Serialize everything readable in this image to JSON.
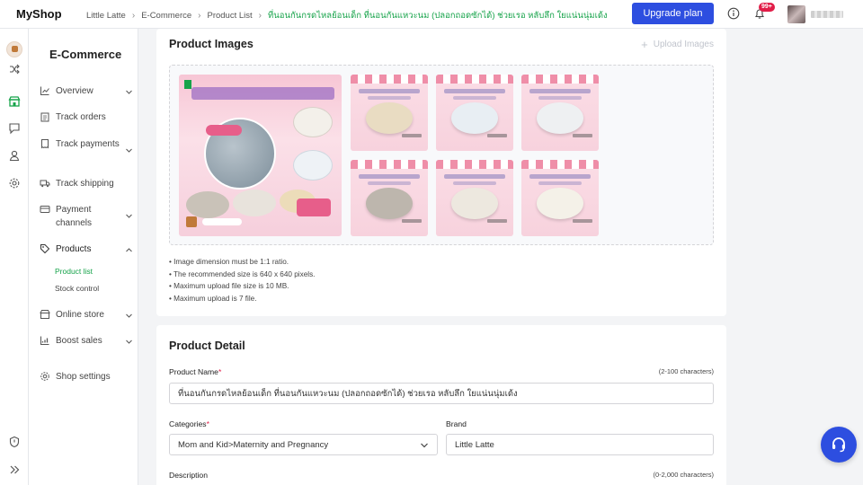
{
  "app": {
    "name": "MyShop"
  },
  "breadcrumb": [
    "Little Latte",
    "E-Commerce",
    "Product List",
    "ที่นอนกันกรดไหลย้อนเด็ก ที่นอนกันแหวะนม (ปลอกถอดซักได้) ช่วยเรอ หลับลึก ใยแน่นนุ่มเด้ง"
  ],
  "header": {
    "upgrade_label": "Upgrade plan",
    "notification_count": "99+"
  },
  "sidebar": {
    "title": "E-Commerce",
    "items": [
      {
        "label": "Overview",
        "icon": "chart-icon"
      },
      {
        "label": "Track orders",
        "icon": "clipboard-icon"
      },
      {
        "label": "Track payments",
        "icon": "receipt-icon"
      },
      {
        "label": "Track shipping",
        "icon": "truck-icon"
      },
      {
        "label": "Payment channels",
        "icon": "card-icon"
      },
      {
        "label": "Products",
        "icon": "tag-icon"
      },
      {
        "label": "Online store",
        "icon": "store-icon"
      },
      {
        "label": "Boost sales",
        "icon": "growth-icon"
      },
      {
        "label": "Shop settings",
        "icon": "gear-icon"
      }
    ],
    "products_sub": [
      "Product list",
      "Stock control"
    ]
  },
  "images_card": {
    "title": "Product Images",
    "upload_label": "Upload Images",
    "hints": [
      "• Image dimension must be 1:1 ratio.",
      "• The recommended size is 640 x 640 pixels.",
      "• Maximum upload file size is 10 MB.",
      "• Maximum upload is 7 file."
    ]
  },
  "detail_card": {
    "title": "Product Detail",
    "name_label": "Product Name",
    "name_limit": "(2-100 characters)",
    "name_value": "ที่นอนกันกรดไหลย้อนเด็ก ที่นอนกันแหวะนม (ปลอกถอดซักได้) ช่วยเรอ หลับลึก ใยแน่นนุ่มเด้ง",
    "categories_label": "Categories",
    "categories_value": "Mom and Kid>Maternity and Pregnancy",
    "brand_label": "Brand",
    "brand_value": "Little Latte",
    "description_label": "Description",
    "description_limit": "(0-2,000 characters)"
  },
  "colors": {
    "accent": "#2d4ee0",
    "active": "#16a34a",
    "required": "#e11d48"
  }
}
